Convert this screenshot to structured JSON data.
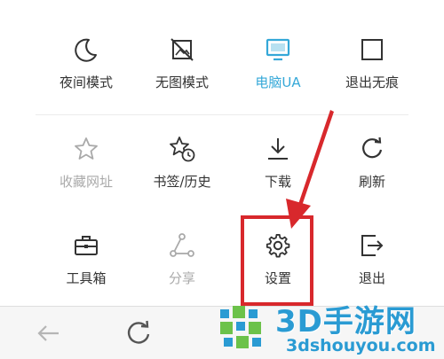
{
  "menu": {
    "row1": [
      {
        "label": "夜间模式",
        "icon": "moon-icon",
        "state": "normal"
      },
      {
        "label": "无图模式",
        "icon": "no-image-icon",
        "state": "normal"
      },
      {
        "label": "电脑UA",
        "icon": "monitor-icon",
        "state": "active"
      },
      {
        "label": "退出无痕",
        "icon": "square-icon",
        "state": "normal"
      }
    ],
    "row2": [
      {
        "label": "收藏网址",
        "icon": "star-icon",
        "state": "disabled"
      },
      {
        "label": "书签/历史",
        "icon": "bookmark-history-icon",
        "state": "normal"
      },
      {
        "label": "下载",
        "icon": "download-icon",
        "state": "normal"
      },
      {
        "label": "刷新",
        "icon": "refresh-icon",
        "state": "normal"
      }
    ],
    "row3": [
      {
        "label": "工具箱",
        "icon": "toolbox-icon",
        "state": "normal"
      },
      {
        "label": "分享",
        "icon": "share-icon",
        "state": "disabled"
      },
      {
        "label": "设置",
        "icon": "gear-icon",
        "state": "normal"
      },
      {
        "label": "退出",
        "icon": "exit-icon",
        "state": "normal"
      }
    ]
  },
  "bottom_bar": {
    "buttons": [
      "back-arrow-icon",
      "refresh-icon"
    ]
  },
  "colors": {
    "active": "#35a8d8",
    "disabled": "#aaaaaa",
    "text": "#333333",
    "highlight": "#d8282c",
    "watermark": "#2a9bd3"
  },
  "watermark": {
    "title": "3D手游网",
    "subtitle": "3dshouyou.com"
  }
}
